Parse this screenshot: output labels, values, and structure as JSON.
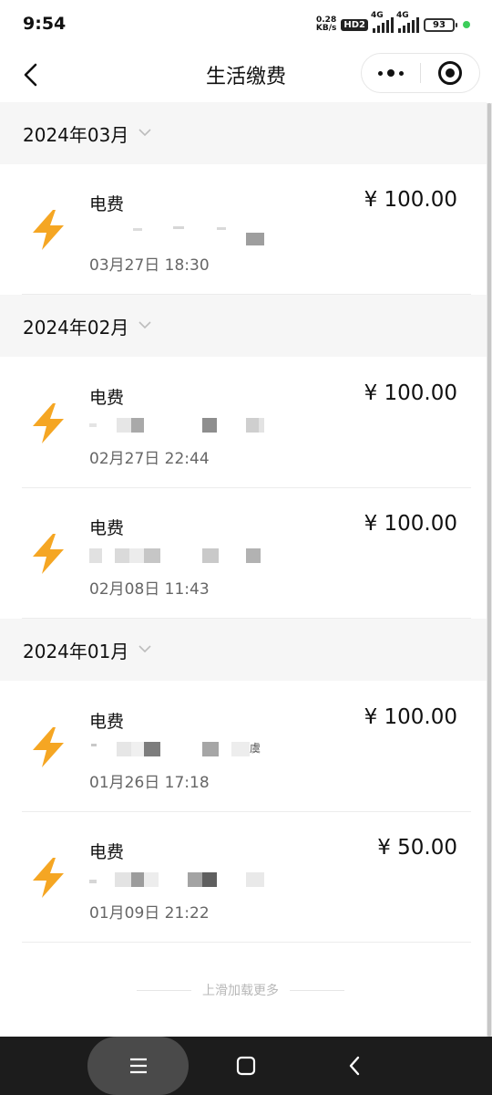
{
  "status_bar": {
    "time": "9:54",
    "net_speed_value": "0.28",
    "net_speed_unit": "KB/s",
    "hd_badge": "HD2",
    "network_1": "4G",
    "network_2": "4G",
    "battery": "93"
  },
  "nav": {
    "title": "生活缴费",
    "back_icon": "chevron-left-icon",
    "more_icon": "more-dots-icon",
    "close_icon": "target-circle-icon"
  },
  "months": [
    {
      "label": "2024年03月",
      "records": [
        {
          "title": "电费",
          "amount": "¥ 100.00",
          "subtitle": "",
          "time": "03月27日 18:30"
        }
      ]
    },
    {
      "label": "2024年02月",
      "records": [
        {
          "title": "电费",
          "amount": "¥ 100.00",
          "subtitle": "",
          "time": "02月27日 22:44"
        },
        {
          "title": "电费",
          "amount": "¥ 100.00",
          "subtitle": "",
          "time": "02月08日 11:43"
        }
      ]
    },
    {
      "label": "2024年01月",
      "records": [
        {
          "title": "电费",
          "amount": "¥ 100.00",
          "subtitle": "虞",
          "time": "01月26日 17:18"
        },
        {
          "title": "电费",
          "amount": "¥ 50.00",
          "subtitle": "",
          "time": "01月09日 21:22"
        }
      ]
    }
  ],
  "load_more": "上滑加载更多",
  "system_nav": {
    "menu_icon": "menu-icon",
    "home_icon": "home-square-icon",
    "back_icon": "back-triangle-icon"
  },
  "colors": {
    "accent_bolt": "#f5a623",
    "month_bg": "#f6f6f6",
    "sys_nav_bg": "#1c1c1c"
  }
}
